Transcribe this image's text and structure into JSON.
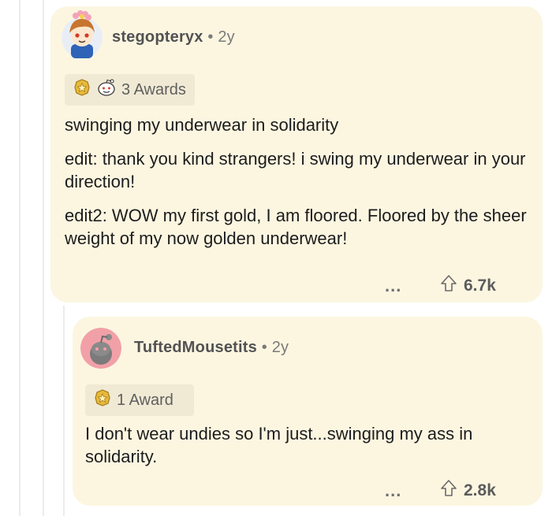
{
  "comments": [
    {
      "username": "stegopteryx",
      "separator": "•",
      "age": "2y",
      "awards_label": "3 Awards",
      "paragraphs": [
        "swinging my underwear in solidarity",
        "edit: thank you kind strangers! i swing my underwear in your direction!",
        "edit2: WOW my first gold, I am floored. Floored by the sheer weight of my now golden underwear!"
      ],
      "more": "...",
      "score": "6.7k"
    },
    {
      "username": "TuftedMousetits",
      "separator": "•",
      "age": "2y",
      "awards_label": "1 Award",
      "paragraphs": [
        "I don't wear undies so I'm just...swinging my ass in solidarity."
      ],
      "more": "...",
      "score": "2.8k"
    }
  ],
  "colors": {
    "card_bg": "#fcf6e1",
    "award_bg": "#f0ead5",
    "avatar2_bg": "#f2a0a8"
  }
}
